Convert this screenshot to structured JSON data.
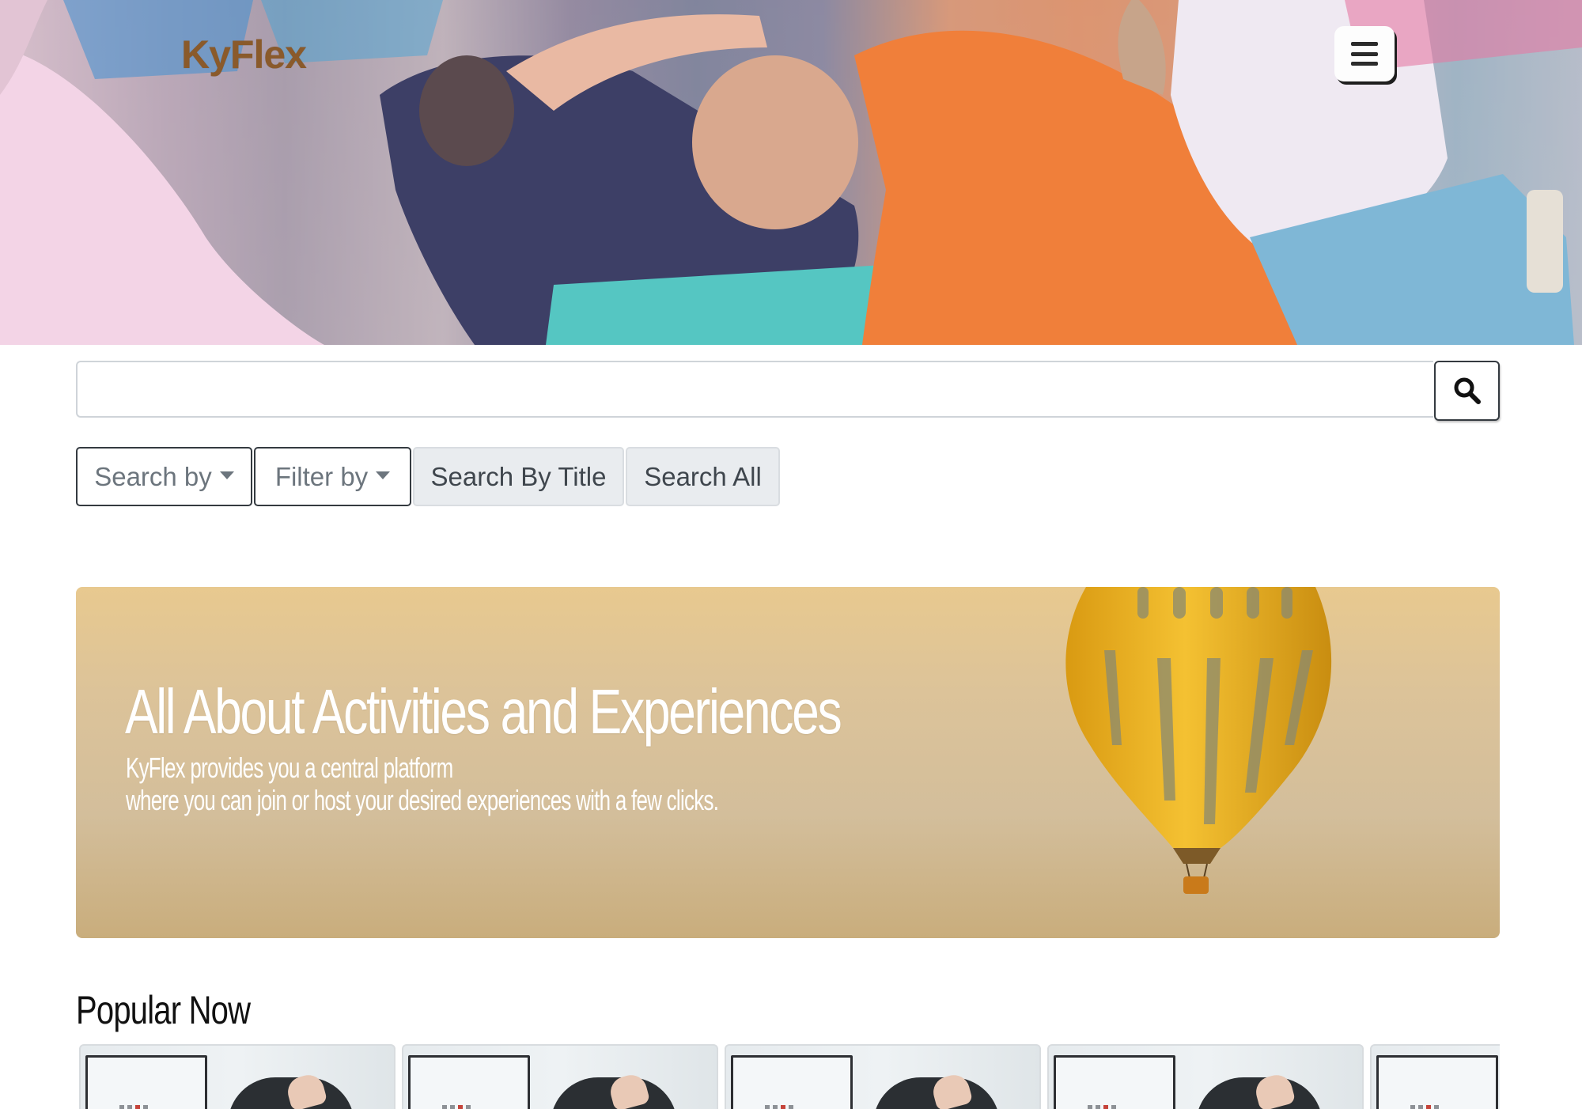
{
  "header": {
    "logo": "KyFlex",
    "menu_icon": "hamburger-menu-icon"
  },
  "search": {
    "value": "",
    "placeholder": "",
    "button_icon": "search-icon"
  },
  "filters": {
    "search_by_label": "Search by",
    "filter_by_label": "Filter by",
    "search_by_title_label": "Search By Title",
    "search_all_label": "Search All"
  },
  "banner": {
    "title": "All About Activities and Experiences",
    "subtitle_line1": "KyFlex provides you a central platform",
    "subtitle_line2": "where you can join or host your desired experiences with a few clicks."
  },
  "popular": {
    "title": "Popular Now",
    "cards": [
      {
        "image": "vr-headset-photo"
      },
      {
        "image": "vr-headset-photo"
      },
      {
        "image": "vr-headset-photo"
      },
      {
        "image": "vr-headset-photo"
      },
      {
        "image": "vr-headset-photo"
      }
    ]
  },
  "colors": {
    "logo": "#8a5a2b",
    "button_light_bg": "#e9ecef",
    "button_outline_border": "#343a40",
    "banner_bg": "#dcc399",
    "balloon": "#e8a91c"
  }
}
